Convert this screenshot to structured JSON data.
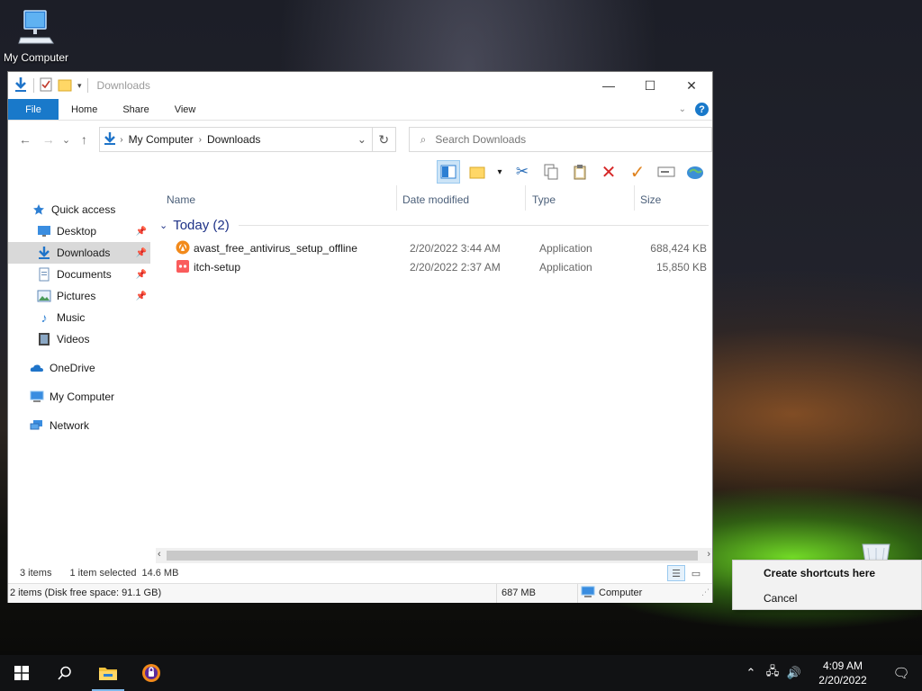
{
  "desktop": {
    "icon_label": "My Computer"
  },
  "window": {
    "title": "Downloads",
    "controls": {
      "minimize": "—",
      "maximize": "☐",
      "close": "✕"
    },
    "ribbon_tabs": [
      "File",
      "Home",
      "Share",
      "View"
    ],
    "help": "?",
    "nav": {
      "back": "←",
      "forward": "→",
      "recent": "⌄",
      "up": "↑"
    },
    "address": {
      "crumbs": [
        "My Computer",
        "Downloads"
      ],
      "separator": "›"
    },
    "search": {
      "placeholder": "Search Downloads"
    },
    "sidebar": [
      {
        "label": "Quick access",
        "icon": "star-icon"
      },
      {
        "label": "Desktop",
        "icon": "desktop-icon",
        "pinned": true
      },
      {
        "label": "Downloads",
        "icon": "downloads-icon",
        "pinned": true,
        "selected": true
      },
      {
        "label": "Documents",
        "icon": "documents-icon",
        "pinned": true
      },
      {
        "label": "Pictures",
        "icon": "pictures-icon",
        "pinned": true
      },
      {
        "label": "Music",
        "icon": "music-icon"
      },
      {
        "label": "Videos",
        "icon": "videos-icon"
      },
      {
        "label": "OneDrive",
        "icon": "onedrive-icon"
      },
      {
        "label": "My Computer",
        "icon": "computer-icon"
      },
      {
        "label": "Network",
        "icon": "network-icon"
      }
    ],
    "columns": [
      "Name",
      "Date modified",
      "Type",
      "Size"
    ],
    "group": {
      "label": "Today (2)"
    },
    "files": [
      {
        "name": "avast_free_antivirus_setup_offline",
        "date": "2/20/2022 3:44 AM",
        "type": "Application",
        "size": "688,424 KB",
        "icon": "avast-icon"
      },
      {
        "name": "itch-setup",
        "date": "2/20/2022 2:37 AM",
        "type": "Application",
        "size": "15,850 KB",
        "icon": "itch-icon"
      }
    ],
    "status": {
      "items": "3 items",
      "selected": "1 item selected",
      "selected_size": "14.6 MB"
    },
    "status2": {
      "summary": "2 items (Disk free space: 91.1 GB)",
      "size": "687 MB",
      "location": "Computer"
    }
  },
  "context_menu": {
    "items": [
      "Create shortcuts here",
      "Cancel"
    ]
  },
  "taskbar": {
    "time": "4:09 AM",
    "date": "2/20/2022"
  }
}
